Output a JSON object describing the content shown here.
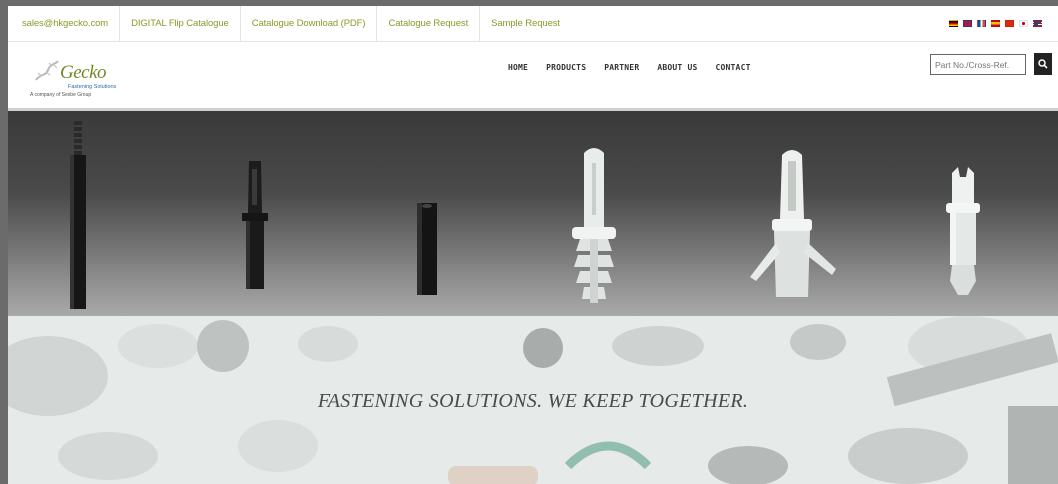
{
  "topbar": {
    "links": [
      "sales@hkgecko.com",
      "DIGITAL Flip Catalogue",
      "Catalogue Download (PDF)",
      "Catalogue Request",
      "Sample Request"
    ],
    "flags": [
      "flag-de",
      "flag-gb",
      "flag-fr",
      "flag-es",
      "flag-cn",
      "flag-jp",
      "flag-us"
    ]
  },
  "logo": {
    "name": "Gecko",
    "tagline": "Fastening Solutions",
    "group": "A company of Sesbe Group"
  },
  "nav": {
    "items": [
      "HOME",
      "PRODUCTS",
      "PARTNER",
      "ABOUT US",
      "CONTACT"
    ]
  },
  "search": {
    "placeholder": "Part No./Cross-Ref.",
    "button_icon": "search-icon"
  },
  "hero": {
    "tagline": "FASTENING SOLUTIONS. WE KEEP TOGETHER."
  },
  "colors": {
    "link_green": "#8a9a2a",
    "brand_green": "#6f8a24",
    "brand_blue": "#2d6ca8",
    "search_button": "#222222"
  }
}
